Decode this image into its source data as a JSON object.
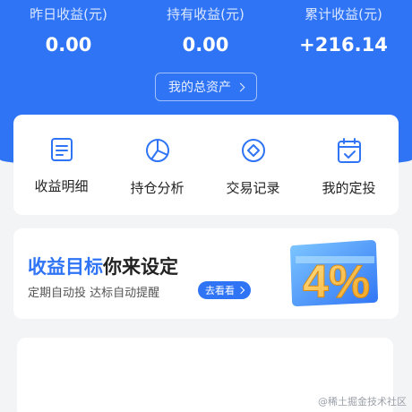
{
  "stats": [
    {
      "label": "昨日收益(元)",
      "value": "0.00"
    },
    {
      "label": "持有收益(元)",
      "value": "0.00"
    },
    {
      "label": "累计收益(元)",
      "value": "+216.14"
    }
  ],
  "assets_button": {
    "label": "我的总资产",
    "icon": "chevron-right-icon"
  },
  "nav": [
    {
      "label": "收益明细",
      "icon": "document-icon"
    },
    {
      "label": "持仓分析",
      "icon": "pie-chart-icon"
    },
    {
      "label": "交易记录",
      "icon": "diamond-record-icon"
    },
    {
      "label": "我的定投",
      "icon": "calendar-check-icon"
    }
  ],
  "promo": {
    "title_highlight": "收益目标",
    "title_rest": "你来设定",
    "subtitle": "定期自动投 达标自动提醒",
    "button_label": "去看看",
    "badge_text": "4%"
  },
  "watermark": "@稀土掘金技术社区",
  "colors": {
    "accent": "#2f74f5",
    "promo_gold": "#f5b82e"
  }
}
